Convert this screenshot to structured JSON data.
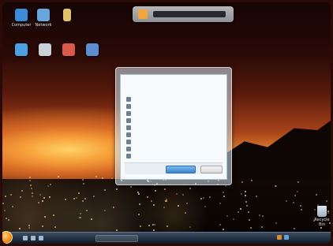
{
  "gadget": {
    "label": ""
  },
  "desktop_icons": [
    {
      "label": "Computer",
      "color": "#3a8bd8"
    },
    {
      "label": "Network",
      "color": "#6aa6de"
    },
    {
      "label": "",
      "color": "#e2c06c"
    },
    {
      "label": "",
      "color": "#4ba2e2"
    },
    {
      "label": "",
      "color": "#c9d0d7"
    },
    {
      "label": "",
      "color": "#d95a4a"
    },
    {
      "label": "",
      "color": "#5d8ed0"
    }
  ],
  "dialog": {
    "title": "",
    "options": [
      "",
      "",
      "",
      "",
      "",
      "",
      "",
      "",
      ""
    ],
    "info": "",
    "cancel_link": "",
    "primary_button": "",
    "secondary_button": ""
  },
  "recycle_bin": {
    "label": "Recycle Bin"
  },
  "taskbar": {
    "clock": ""
  },
  "colors": {
    "accent": "#2e64ad",
    "sunset": "#f7a23b",
    "taskbar": "#1a2533"
  }
}
